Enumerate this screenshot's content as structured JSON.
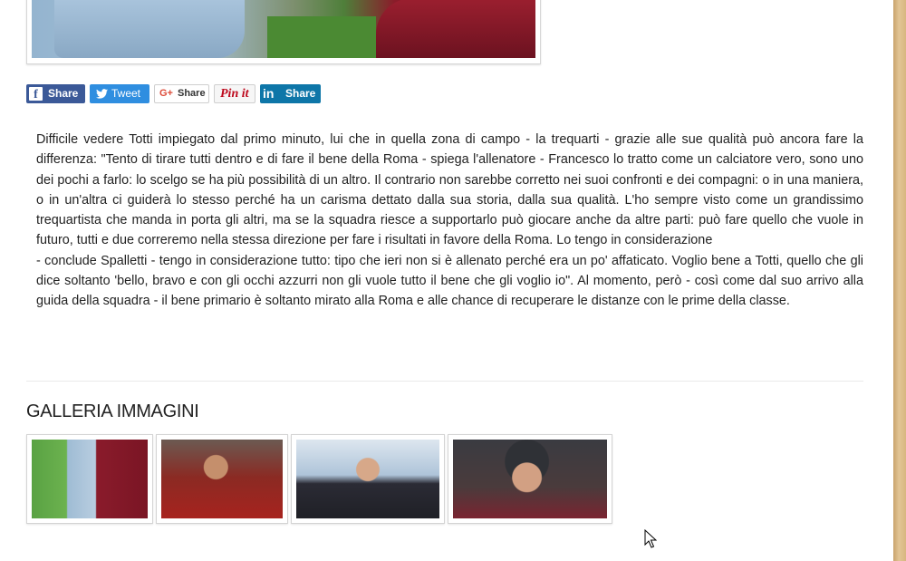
{
  "share_bar": {
    "facebook": {
      "icon": "facebook-icon",
      "label": "Share",
      "color": "#3b5998"
    },
    "twitter": {
      "icon": "twitter-icon",
      "label": "Tweet",
      "color": "#2f8ee0"
    },
    "googleplus": {
      "icon": "google-plus-icon",
      "glyph": "G+",
      "label": "Share",
      "color": "#dd4b39"
    },
    "pinterest": {
      "icon": "pinterest-icon",
      "label": "Pin it",
      "color": "#bd081c"
    },
    "linkedin": {
      "icon": "linkedin-icon",
      "glyph": "in",
      "label": "Share",
      "color": "#0e76a8"
    }
  },
  "article": {
    "paragraph_1": "Difficile vedere Totti impiegato dal primo minuto, lui che in quella zona di campo - la trequarti - grazie alle sue qualità può ancora fare la differenza: \"Tento di tirare tutti dentro e di fare il bene della Roma - spiega l'allenatore - Francesco lo tratto come un calciatore vero, sono uno dei pochi a farlo: lo scelgo se ha più possibilità di un altro. Il contrario non sarebbe corretto nei suoi confronti e dei compagni: o in una maniera, o in un'altra ci guiderà lo stesso perché ha un carisma dettato dalla sua storia, dalla sua qualità. L'ho sempre visto come un grandissimo trequartista che manda in porta gli altri, ma se la squadra riesce a supportarlo può giocare anche da altre parti: può fare quello che vuole in futuro, tutti e due correremo nella stessa direzione per fare i risultati in favore della Roma. Lo tengo in considerazione",
    "paragraph_2": "- conclude Spalletti - tengo in considerazione tutto: tipo che ieri non si è allenato perché era un po' affaticato. Voglio bene a Totti, quello che gli dice soltanto 'bello, bravo e con gli occhi azzurri non gli vuole tutto il bene che gli voglio io\". Al momento, però - così come dal suo arrivo alla guida della squadra - il bene primario è soltanto mirato alla Roma e alle chance di recuperare le distanze con le prime della classe."
  },
  "gallery": {
    "title": "GALLERIA IMMAGINI",
    "thumbnails": [
      "thumbnail-1",
      "thumbnail-2",
      "thumbnail-3",
      "thumbnail-4"
    ]
  },
  "colors": {
    "text": "#222222",
    "sidebar_strip": "#d8b680"
  }
}
